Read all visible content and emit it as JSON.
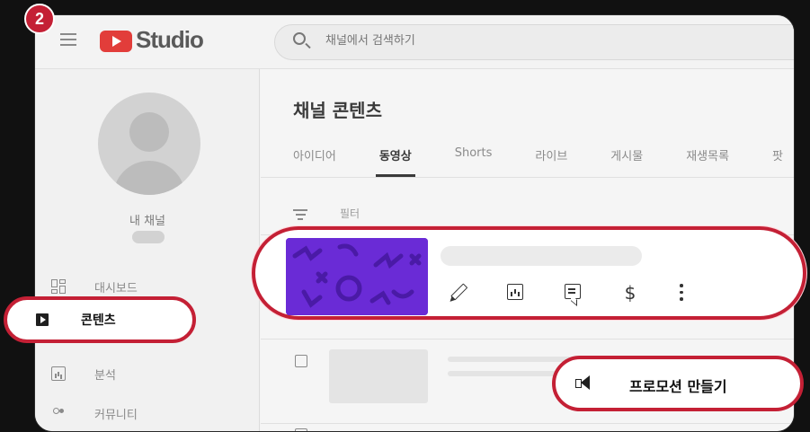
{
  "step_number": "2",
  "header": {
    "logo_text": "Studio",
    "search_placeholder": "채널에서 검색하기"
  },
  "sidebar": {
    "channel_name": "내 채널",
    "items": [
      {
        "label": "대시보드",
        "icon": "dashboard-icon"
      },
      {
        "label": "콘텐츠",
        "icon": "content-icon",
        "active": true
      },
      {
        "label": "분석",
        "icon": "analytics-icon"
      },
      {
        "label": "커뮤니티",
        "icon": "community-icon"
      }
    ]
  },
  "main": {
    "title": "채널 콘텐츠",
    "tabs": [
      {
        "label": "아이디어"
      },
      {
        "label": "동영상",
        "active": true
      },
      {
        "label": "Shorts"
      },
      {
        "label": "라이브"
      },
      {
        "label": "게시물"
      },
      {
        "label": "재생목록"
      },
      {
        "label": "팟"
      }
    ],
    "filter_label": "필터"
  },
  "video_row": {
    "actions": [
      "edit-icon",
      "analytics-icon",
      "comments-icon",
      "monetization-icon",
      "more-icon"
    ],
    "dollar_glyph": "$"
  },
  "promotion": {
    "label": "프로모션 만들기",
    "icon": "megaphone-icon"
  },
  "colors": {
    "highlight": "#c42035",
    "thumbnail": "#6a2bd6",
    "youtube_red": "#e23d3a"
  }
}
